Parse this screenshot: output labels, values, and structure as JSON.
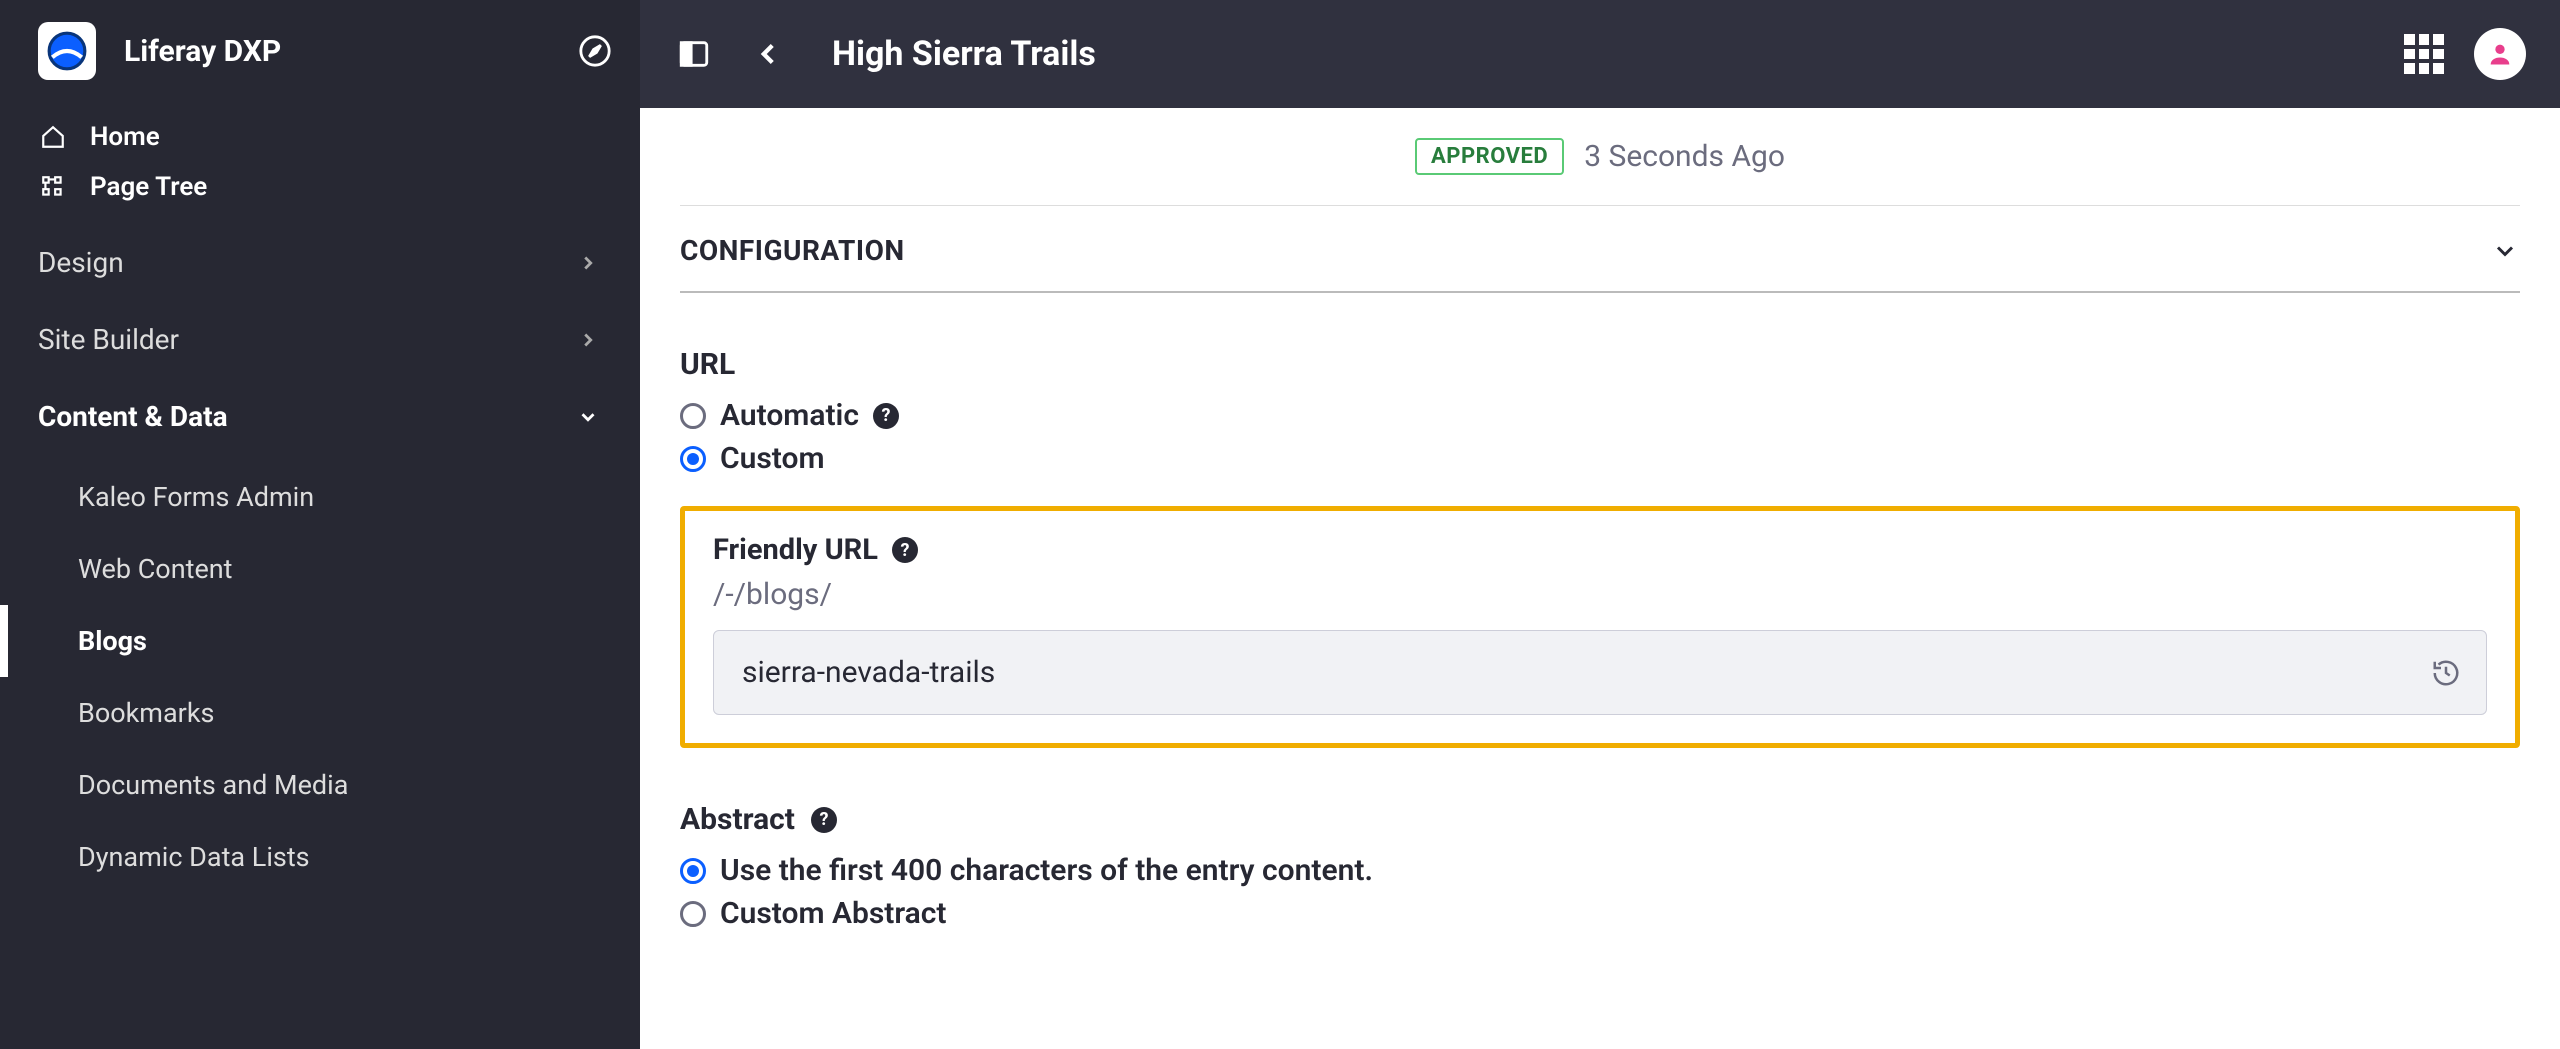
{
  "sidebar": {
    "app_title": "Liferay DXP",
    "quicklinks": [
      {
        "label": "Home"
      },
      {
        "label": "Page Tree"
      }
    ],
    "sections": [
      {
        "label": "Design",
        "expanded": false
      },
      {
        "label": "Site Builder",
        "expanded": false
      },
      {
        "label": "Content & Data",
        "expanded": true
      }
    ],
    "content_data_items": [
      {
        "label": "Kaleo Forms Admin",
        "active": false
      },
      {
        "label": "Web Content",
        "active": false
      },
      {
        "label": "Blogs",
        "active": true
      },
      {
        "label": "Bookmarks",
        "active": false
      },
      {
        "label": "Documents and Media",
        "active": false
      },
      {
        "label": "Dynamic Data Lists",
        "active": false
      }
    ]
  },
  "topbar": {
    "title": "High Sierra Trails"
  },
  "status": {
    "badge": "APPROVED",
    "time": "3 Seconds Ago"
  },
  "panel": {
    "title": "CONFIGURATION"
  },
  "url_section": {
    "heading": "URL",
    "options": {
      "automatic": "Automatic",
      "custom": "Custom"
    },
    "selected": "custom"
  },
  "friendly_url": {
    "label": "Friendly URL",
    "prefix": "/-/blogs/",
    "value": "sierra-nevada-trails"
  },
  "abstract_section": {
    "heading": "Abstract",
    "options": {
      "first400": "Use the first 400 characters of the entry content.",
      "custom": "Custom Abstract"
    },
    "selected": "first400"
  }
}
